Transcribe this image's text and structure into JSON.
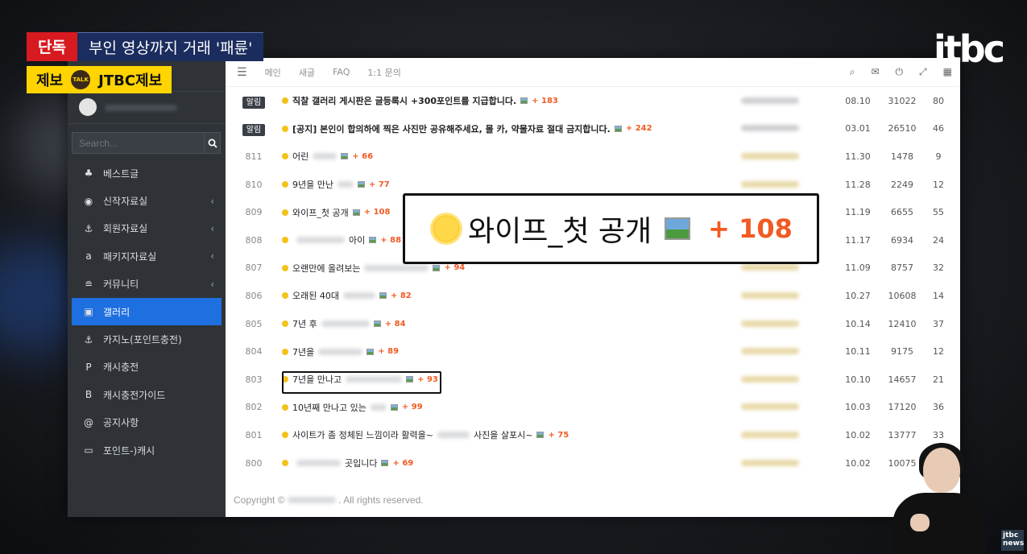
{
  "broadcast": {
    "tag": "단독",
    "headline": "부인 영상까지 거래 '패륜'",
    "tip_label": "제보",
    "tip_talk": "TALK",
    "tip_channel": "JTBC제보",
    "logo": "jtbc",
    "logo_small": "jtbc news"
  },
  "sidebar": {
    "search_placeholder": "Search...",
    "items": [
      {
        "label": "베스트글",
        "icon": "android-icon",
        "glyph": "♣",
        "chevron": false,
        "active": false
      },
      {
        "label": "신작자료실",
        "icon": "circle-play-icon",
        "glyph": "◉",
        "chevron": true,
        "active": false
      },
      {
        "label": "회원자료실",
        "icon": "anchor-icon",
        "glyph": "⚓",
        "chevron": true,
        "active": false
      },
      {
        "label": "패키지자료실",
        "icon": "amazon-icon",
        "glyph": "a",
        "chevron": true,
        "active": false
      },
      {
        "label": "커뮤니티",
        "icon": "road-icon",
        "glyph": "≘",
        "chevron": true,
        "active": false
      },
      {
        "label": "갤러리",
        "icon": "image-icon",
        "glyph": "▣",
        "chevron": false,
        "active": true
      },
      {
        "label": "카지노(포인트충전)",
        "icon": "anchor-icon",
        "glyph": "⚓",
        "chevron": false,
        "active": false
      },
      {
        "label": "캐시충전",
        "icon": "paypal-icon",
        "glyph": "P",
        "chevron": false,
        "active": false
      },
      {
        "label": "캐시충전가이드",
        "icon": "bitcoin-icon",
        "glyph": "B",
        "chevron": false,
        "active": false
      },
      {
        "label": "공지사항",
        "icon": "at-icon",
        "glyph": "@",
        "chevron": false,
        "active": false
      },
      {
        "label": "포인트-)캐시",
        "icon": "visa-card-icon",
        "glyph": "▭",
        "chevron": false,
        "active": false
      }
    ]
  },
  "topnav": {
    "links": [
      "메인",
      "새글",
      "FAQ",
      "1:1 문의"
    ]
  },
  "board": {
    "rows": [
      {
        "num": "알림",
        "badge": true,
        "title": "직찰 갤러리 게시판은 글등록시 +300포인트를 지급합니다.",
        "title_blur": 0,
        "tail": "",
        "comments": "+ 183",
        "bold": true,
        "date": "08.10",
        "views": "31022",
        "likes": "80"
      },
      {
        "num": "알림",
        "badge": true,
        "title": "[공지] 본인이 합의하에 찍은 사진만 공유해주세요, 몰 카, 약물자료 절대 금지합니다.",
        "title_blur": 0,
        "tail": "",
        "comments": "+ 242",
        "bold": true,
        "date": "03.01",
        "views": "26510",
        "likes": "46"
      },
      {
        "num": "811",
        "badge": false,
        "title": "어린",
        "title_blur": 30,
        "tail": "",
        "comments": "+ 66",
        "bold": false,
        "date": "11.30",
        "views": "1478",
        "likes": "9"
      },
      {
        "num": "810",
        "badge": false,
        "title": "9년을 만난",
        "title_blur": 20,
        "tail": "",
        "comments": "+ 77",
        "bold": false,
        "date": "11.28",
        "views": "2249",
        "likes": "12"
      },
      {
        "num": "809",
        "badge": false,
        "title": "와이프_첫 공개",
        "title_blur": 0,
        "tail": "",
        "comments": "+ 108",
        "bold": false,
        "date": "11.19",
        "views": "6655",
        "likes": "55"
      },
      {
        "num": "808",
        "badge": false,
        "title": "",
        "title_blur": 60,
        "tail": "아이",
        "comments": "+ 88",
        "bold": false,
        "date": "11.17",
        "views": "6934",
        "likes": "24"
      },
      {
        "num": "807",
        "badge": false,
        "title": "오랜만에 올려보는",
        "title_blur": 80,
        "tail": "",
        "comments": "+ 94",
        "bold": false,
        "date": "11.09",
        "views": "8757",
        "likes": "32"
      },
      {
        "num": "806",
        "badge": false,
        "title": "오래된 40대",
        "title_blur": 40,
        "tail": "",
        "comments": "+ 82",
        "bold": false,
        "date": "10.27",
        "views": "10608",
        "likes": "14"
      },
      {
        "num": "805",
        "badge": false,
        "title": "7년 후",
        "title_blur": 60,
        "tail": "",
        "comments": "+ 84",
        "bold": false,
        "date": "10.14",
        "views": "12410",
        "likes": "37"
      },
      {
        "num": "804",
        "badge": false,
        "title": "7년을",
        "title_blur": 55,
        "tail": "",
        "comments": "+ 89",
        "bold": false,
        "date": "10.11",
        "views": "9175",
        "likes": "12"
      },
      {
        "num": "803",
        "badge": false,
        "title": "7년을 만나고",
        "title_blur": 70,
        "tail": "",
        "comments": "+ 93",
        "bold": false,
        "date": "10.10",
        "views": "14657",
        "likes": "21"
      },
      {
        "num": "802",
        "badge": false,
        "title": "10년째 만나고 있는",
        "title_blur": 20,
        "tail": "",
        "comments": "+ 99",
        "bold": false,
        "date": "10.03",
        "views": "17120",
        "likes": "36"
      },
      {
        "num": "801",
        "badge": false,
        "title": "사이트가 좀 정체된 느낌이라 활력을~",
        "title_blur": 40,
        "tail": "사진을 살포시~",
        "comments": "+ 75",
        "bold": false,
        "date": "10.02",
        "views": "13777",
        "likes": "33"
      },
      {
        "num": "800",
        "badge": false,
        "title": "",
        "title_blur": 55,
        "tail": "곳입니다",
        "comments": "+ 69",
        "bold": false,
        "date": "10.02",
        "views": "10075",
        "likes": ""
      }
    ]
  },
  "footer": {
    "prefix": "Copyright ©",
    "suffix": ". All rights reserved."
  },
  "callout": {
    "title": "와이프_첫 공개",
    "comments": "+ 108"
  },
  "colors": {
    "sidebar_bg": "#2f3338",
    "active": "#1e6fe0",
    "comment": "#f15a22",
    "notice_badge": "#3a3f47",
    "news_red": "#d71920",
    "news_navy": "#1b2c5e",
    "tip_yellow": "#ffd400"
  }
}
